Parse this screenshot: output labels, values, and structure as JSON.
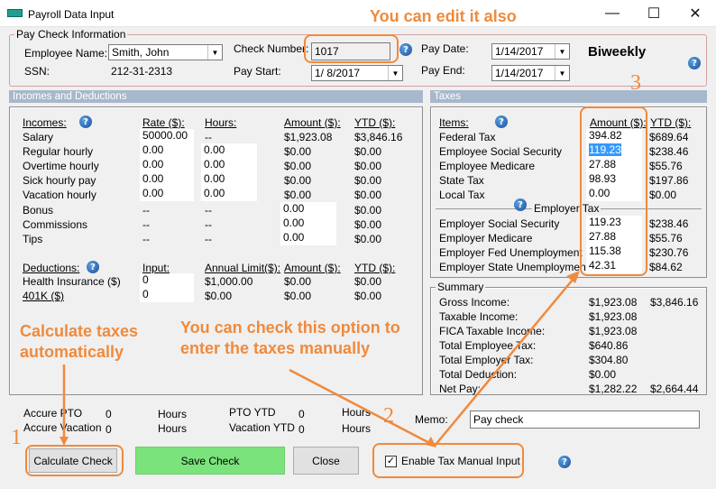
{
  "window": {
    "title": "Payroll Data Input",
    "minimize": "—",
    "maximize": "☐",
    "close": "✕"
  },
  "paycheck": {
    "legend": "Pay Check Information",
    "employee_name_label": "Employee Name:",
    "employee_name": "Smith, John",
    "ssn_label": "SSN:",
    "ssn": "212-31-2313",
    "check_number_label": "Check Number:",
    "check_number": "1017",
    "pay_start_label": "Pay Start:",
    "pay_start": "1/  8/2017",
    "pay_date_label": "Pay Date:",
    "pay_date": "1/14/2017",
    "pay_end_label": "Pay End:",
    "pay_end": "1/14/2017",
    "frequency": "Biweekly"
  },
  "incomes": {
    "panel_title": "Incomes and Deductions",
    "headers": {
      "items": "Incomes:",
      "rate": "Rate ($):",
      "hours": "Hours:",
      "amount": "Amount ($):",
      "ytd": "YTD ($):"
    },
    "rows": [
      {
        "name": "Salary",
        "rate": "50000.00",
        "hours": "--",
        "amount": "$1,923.08",
        "ytd": "$3,846.16"
      },
      {
        "name": "Regular hourly",
        "rate": "0.00",
        "hours": "0.00",
        "amount": "$0.00",
        "ytd": "$0.00"
      },
      {
        "name": "Overtime hourly",
        "rate": "0.00",
        "hours": "0.00",
        "amount": "$0.00",
        "ytd": "$0.00"
      },
      {
        "name": "Sick hourly pay",
        "rate": "0.00",
        "hours": "0.00",
        "amount": "$0.00",
        "ytd": "$0.00"
      },
      {
        "name": "Vacation hourly",
        "rate": "0.00",
        "hours": "0.00",
        "amount": "$0.00",
        "ytd": "$0.00"
      },
      {
        "name": "Bonus",
        "rate": "--",
        "hours": "--",
        "amount": "0.00",
        "ytd": "$0.00"
      },
      {
        "name": "Commissions",
        "rate": "--",
        "hours": "--",
        "amount": "0.00",
        "ytd": "$0.00"
      },
      {
        "name": "Tips",
        "rate": "--",
        "hours": "--",
        "amount": "0.00",
        "ytd": "$0.00"
      }
    ],
    "deduction_headers": {
      "items": "Deductions:",
      "input": "Input:",
      "limit": "Annual Limit($):",
      "amount": "Amount ($):",
      "ytd": "YTD ($):"
    },
    "deductions": [
      {
        "name": "Health Insurance  ($)",
        "input": "0",
        "limit": "$1,000.00",
        "amount": "$0.00",
        "ytd": "$0.00"
      },
      {
        "name": "401K  ($)",
        "input": "0",
        "limit": "$0.00",
        "amount": "$0.00",
        "ytd": "$0.00"
      }
    ]
  },
  "taxes": {
    "panel_title": "Taxes",
    "headers": {
      "items": "Items:",
      "amount": "Amount ($):",
      "ytd": "YTD ($):"
    },
    "employee_rows": [
      {
        "name": "Federal Tax",
        "amount": "394.82",
        "ytd": "$689.64"
      },
      {
        "name": "Employee Social Security",
        "amount": "119.23",
        "ytd": "$238.46"
      },
      {
        "name": "Employee Medicare",
        "amount": "27.88",
        "ytd": "$55.76"
      },
      {
        "name": "State Tax",
        "amount": "98.93",
        "ytd": "$197.86"
      },
      {
        "name": "Local Tax",
        "amount": "0.00",
        "ytd": "$0.00"
      }
    ],
    "employer_label": "Employer Tax",
    "employer_rows": [
      {
        "name": "Employer Social Security",
        "amount": "119.23",
        "ytd": "$238.46"
      },
      {
        "name": "Employer Medicare",
        "amount": "27.88",
        "ytd": "$55.76"
      },
      {
        "name": "Employer Fed Unemployment",
        "amount": "115.38",
        "ytd": "$230.76"
      },
      {
        "name": "Employer State Unemployment",
        "amount": "42.31",
        "ytd": "$84.62"
      }
    ]
  },
  "summary": {
    "legend": "Summary",
    "rows": [
      {
        "name": "Gross Income:",
        "amount": "$1,923.08",
        "ytd": "$3,846.16"
      },
      {
        "name": "Taxable Income:",
        "amount": "$1,923.08",
        "ytd": ""
      },
      {
        "name": "FICA Taxable Income:",
        "amount": "$1,923.08",
        "ytd": ""
      },
      {
        "name": "Total Employee Tax:",
        "amount": "$640.86",
        "ytd": ""
      },
      {
        "name": "Total Employer Tax:",
        "amount": "$304.80",
        "ytd": ""
      },
      {
        "name": "Total Deduction:",
        "amount": "$0.00",
        "ytd": ""
      },
      {
        "name": "Net Pay:",
        "amount": "$1,282.22",
        "ytd": "$2,664.44"
      }
    ]
  },
  "accrual": {
    "accure_pto_label": "Accure PTO",
    "accure_pto": "0",
    "accure_vacation_label": "Accure Vacation",
    "accure_vacation": "0",
    "hours_label": "Hours",
    "pto_ytd_label": "PTO YTD",
    "pto_ytd": "0",
    "vacation_ytd_label": "Vacation YTD",
    "vacation_ytd": "0"
  },
  "memo": {
    "label": "Memo:",
    "value": "Pay check"
  },
  "buttons": {
    "calculate": "Calculate Check",
    "save": "Save Check",
    "close": "Close",
    "manual_tax": "Enable Tax Manual Input",
    "manual_tax_checked": "✓"
  },
  "annotations": {
    "edit": "You can edit it also",
    "calc": "Calculate taxes automatically",
    "manual": "You can check this option to enter the taxes manually",
    "num1": "1",
    "num2": "2",
    "num3": "3"
  },
  "colors": {
    "annotation": "#f08a3c",
    "panel_header": "#a8b8cc",
    "save_button": "#7be37b"
  },
  "icons": {
    "help": "question-mark-circle"
  }
}
